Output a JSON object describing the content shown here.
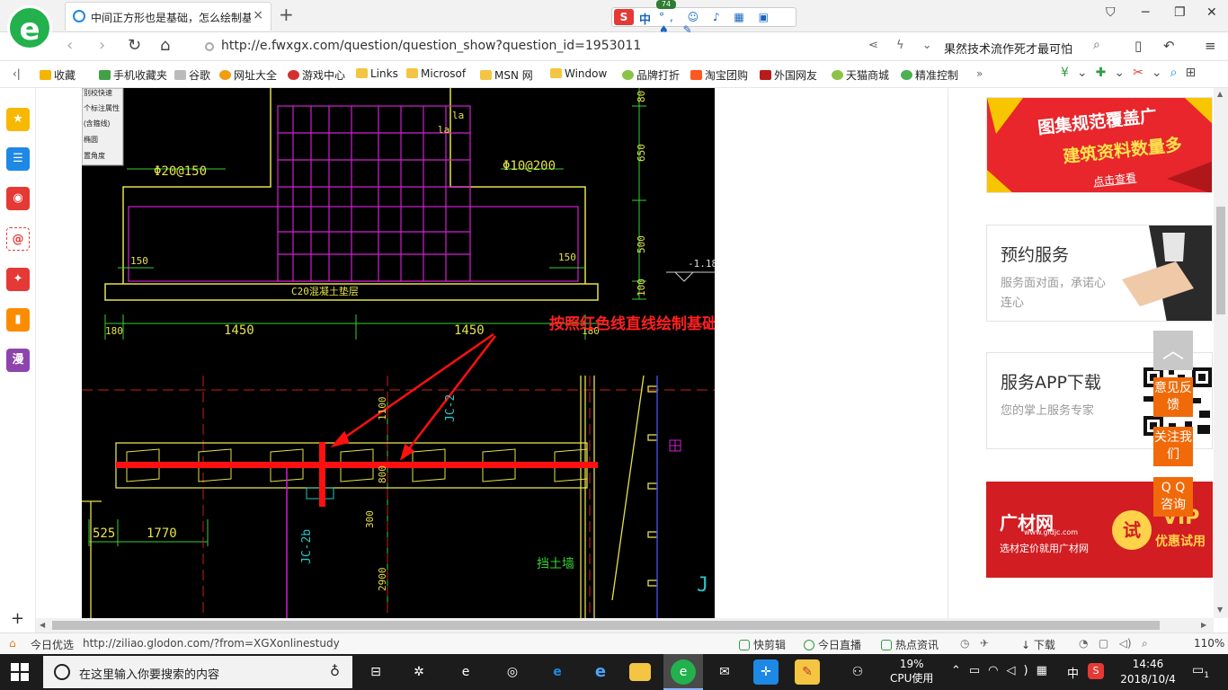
{
  "browser": {
    "tab_title": "中间正方形也是基础，怎么绘制基础梁",
    "tab_close": "×",
    "new_tab": "+",
    "logo_letter": "e",
    "ime": {
      "label": "中",
      "badge": "74"
    },
    "url": "http://e.fwxgx.com/question/question_show?question_id=1953011",
    "search_text": "果然技术流作死才最可怕",
    "bookmarks": [
      {
        "label": "收藏",
        "color": "#f5b400"
      },
      {
        "label": "手机收藏夹",
        "color": "#43a047"
      },
      {
        "label": "谷歌",
        "color": "#9e9e9e"
      },
      {
        "label": "网址大全",
        "color": "#f39c12"
      },
      {
        "label": "游戏中心",
        "color": "#d32f2f"
      },
      {
        "label": "Links",
        "color": "#f4c542"
      },
      {
        "label": "Microsof",
        "color": "#f4c542"
      },
      {
        "label": "MSN 网",
        "color": "#f4c542"
      },
      {
        "label": "Window",
        "color": "#f4c542"
      },
      {
        "label": "品牌打折",
        "color": "#8bc34a"
      },
      {
        "label": "淘宝团购",
        "color": "#ff5722"
      },
      {
        "label": "外国网友",
        "color": "#b71c1c"
      },
      {
        "label": "天猫商城",
        "color": "#8bc34a"
      },
      {
        "label": "精准控制",
        "color": "#4caf50"
      }
    ]
  },
  "sidebar": {
    "items": [
      {
        "name": "favorites-star-icon",
        "color": "#f6b800",
        "glyph": "★"
      },
      {
        "name": "news-icon",
        "color": "#1e88e5",
        "glyph": "☰"
      },
      {
        "name": "weibo-icon",
        "color": "#e53935",
        "glyph": "◉"
      },
      {
        "name": "mail-icon",
        "color": "#e53935",
        "glyph": "@"
      },
      {
        "name": "game-icon",
        "color": "#e53935",
        "glyph": "✦"
      },
      {
        "name": "notes-icon",
        "color": "#fb8c00",
        "glyph": "▮"
      },
      {
        "name": "comic-icon",
        "color": "#8e44ad",
        "glyph": "漫"
      }
    ],
    "add": "+"
  },
  "cad": {
    "annotation": "按照红色线直线绘制基础梁",
    "menu_items": [
      "别校快速",
      "个标注属性",
      "(含箍线)",
      "椭圆",
      "置角度"
    ],
    "labels": {
      "rebar_left": "Φ20@150",
      "rebar_right": "Φ10@200",
      "la_top": "la",
      "la_bottom": "la",
      "dim_150_left": "150",
      "dim_150_right": "150",
      "cushion": "C20混凝土垫层",
      "dim_180": "180",
      "dim_1450_left": "1450",
      "dim_1450_right": "1450",
      "dim_180b": "180",
      "v_80": "80",
      "v_650": "650",
      "v_500": "500",
      "v_100": "100",
      "elev": "-1.18",
      "beam_jc2": "JC-2",
      "beam_jc2b": "JC-2b",
      "v_1100": "1100",
      "v_800": "800",
      "v_300": "300",
      "v_2900": "2900",
      "dim_525": "525",
      "dim_1770": "1770",
      "retaining_wall": "挡土墙",
      "corner_j": "J"
    }
  },
  "ads": {
    "banner1": {
      "line1": "图集规范覆盖广",
      "line2": "建筑资料数量多",
      "cta": "点击查看"
    },
    "service": {
      "title": "预约服务",
      "desc": "服务面对面，承诺心连心"
    },
    "app": {
      "title": "服务APP下载",
      "desc": "您的掌上服务专家"
    },
    "guangcai": {
      "brand": "广材网",
      "url": "www.gldjc.com",
      "slogan": "选材定价就用广材网",
      "try": "试",
      "vip": "VIP",
      "vip_text": "优惠试用"
    }
  },
  "float_buttons": [
    {
      "name": "feedback-button",
      "label": "意见反馈"
    },
    {
      "name": "follow-us-button",
      "label": "关注我们"
    },
    {
      "name": "qq-consult-button",
      "label": "Q Q 咨询"
    }
  ],
  "status_bar": {
    "left_label": "今日优选",
    "hover_url": "http://ziliao.glodon.com/?from=XGXonlinestudy",
    "kuaijian": "快剪辑",
    "live": "今日直播",
    "news": "热点资讯",
    "download": "下载",
    "zoom": "110%"
  },
  "taskbar": {
    "search_placeholder": "在这里输入你要搜索的内容",
    "cpu_percent": "19%",
    "cpu_label": "CPU使用",
    "ime": "中",
    "time": "14:46",
    "date": "2018/10/4",
    "notify_count": "1"
  }
}
